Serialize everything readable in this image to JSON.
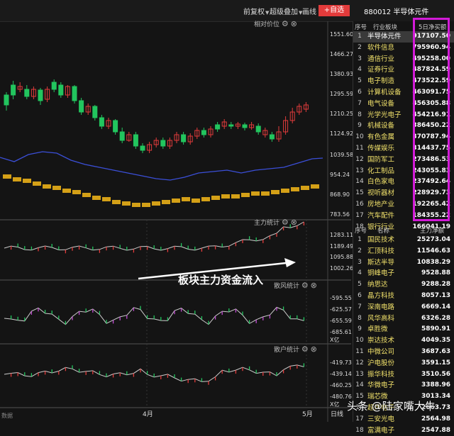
{
  "toolbar": {
    "buttons": [
      {
        "label": "前复权",
        "has_caret": true
      },
      {
        "label": "超级叠加",
        "has_caret": true
      },
      {
        "label": "画线",
        "has_caret": false
      }
    ],
    "add_label": "+自选",
    "security_title": "880012 半导体元件"
  },
  "panels": {
    "main": {
      "label": "相对价位",
      "ticks": [
        "1551.60",
        "1466.27",
        "1380.93",
        "1295.59",
        "1210.25",
        "1124.92",
        "1039.58",
        "954.24",
        "868.90",
        "783.56"
      ]
    },
    "p2": {
      "label": "主力统计",
      "ticks": [
        "1283.11",
        "1189.49",
        "1095.88",
        "1002.26"
      ]
    },
    "p3": {
      "label": "散风统计",
      "ticks": [
        "-595.55",
        "-625.57",
        "-655.59",
        "-685.61"
      ],
      "unit": "X亿"
    },
    "p4": {
      "label": "散户统计",
      "ticks": [
        "-419.73",
        "-439.14",
        "-460.25",
        "-480.76"
      ],
      "unit": "X亿"
    }
  },
  "axis": {
    "months": [
      "4月",
      "5月"
    ],
    "bottom_left": "数据",
    "bottom_right": "日线"
  },
  "annotation": "板块主力资金流入",
  "table1": {
    "headers": {
      "idx": "序号",
      "name": "行业板块",
      "value": "5日净买额"
    },
    "rows": [
      {
        "idx": "1",
        "name": "半导体元件",
        "value": "917107.50"
      },
      {
        "idx": "2",
        "name": "软件信息",
        "value": "795960.94"
      },
      {
        "idx": "3",
        "name": "通信行业",
        "value": "495258.00"
      },
      {
        "idx": "4",
        "name": "证券行业",
        "value": "487824.59"
      },
      {
        "idx": "5",
        "name": "电子制造",
        "value": "473522.59"
      },
      {
        "idx": "6",
        "name": "计算机设备",
        "value": "463091.75"
      },
      {
        "idx": "7",
        "name": "电气设备",
        "value": "456305.88"
      },
      {
        "idx": "8",
        "name": "光学光电子",
        "value": "454216.91"
      },
      {
        "idx": "9",
        "name": "机械设备",
        "value": "386450.22"
      },
      {
        "idx": "10",
        "name": "有色金属",
        "value": "370787.94"
      },
      {
        "idx": "11",
        "name": "传媒娱乐",
        "value": "314437.75"
      },
      {
        "idx": "12",
        "name": "国防军工",
        "value": "273486.53"
      },
      {
        "idx": "13",
        "name": "化工制品",
        "value": "243055.83"
      },
      {
        "idx": "14",
        "name": "白色家电",
        "value": "237492.64"
      },
      {
        "idx": "15",
        "name": "视听器材",
        "value": "228929.73"
      },
      {
        "idx": "16",
        "name": "房地产业",
        "value": "192265.42"
      },
      {
        "idx": "17",
        "name": "汽车配件",
        "value": "184355.22"
      },
      {
        "idx": "18",
        "name": "银行行业",
        "value": "166041.19"
      }
    ]
  },
  "table2": {
    "headers": {
      "idx": "序号",
      "name": "名称",
      "value": "主力净额"
    },
    "rows": [
      {
        "idx": "1",
        "name": "国民技术",
        "value": "25273.04"
      },
      {
        "idx": "2",
        "name": "汇顶科技",
        "value": "11546.63"
      },
      {
        "idx": "3",
        "name": "斯达半导",
        "value": "10838.29"
      },
      {
        "idx": "4",
        "name": "铜峰电子",
        "value": "9528.88"
      },
      {
        "idx": "5",
        "name": "纳思达",
        "value": "9288.28"
      },
      {
        "idx": "6",
        "name": "晶方科技",
        "value": "8057.13"
      },
      {
        "idx": "7",
        "name": "深南电路",
        "value": "6669.14"
      },
      {
        "idx": "8",
        "name": "风华高科",
        "value": "6326.28"
      },
      {
        "idx": "9",
        "name": "卓胜微",
        "value": "5890.91"
      },
      {
        "idx": "10",
        "name": "崇达技术",
        "value": "4049.35"
      },
      {
        "idx": "11",
        "name": "中微公司",
        "value": "3687.63"
      },
      {
        "idx": "12",
        "name": "沪电股份",
        "value": "3591.15"
      },
      {
        "idx": "13",
        "name": "振华科技",
        "value": "3510.56"
      },
      {
        "idx": "14",
        "name": "华微电子",
        "value": "3388.96"
      },
      {
        "idx": "15",
        "name": "瑞芯微",
        "value": "3013.34"
      },
      {
        "idx": "16",
        "name": "超声电子",
        "value": "2663.73"
      },
      {
        "idx": "17",
        "name": "三安光电",
        "value": "2564.98"
      },
      {
        "idx": "18",
        "name": "富满电子",
        "value": "2547.88"
      }
    ]
  },
  "watermark": "头条 @陆家嘴大牛",
  "colors": {
    "up": "#e23b3b",
    "down": "#22c55e",
    "blue_line": "#3b4fd8",
    "yellow_bars": "#d4a017",
    "highlight_box": "#d21ad7"
  }
}
